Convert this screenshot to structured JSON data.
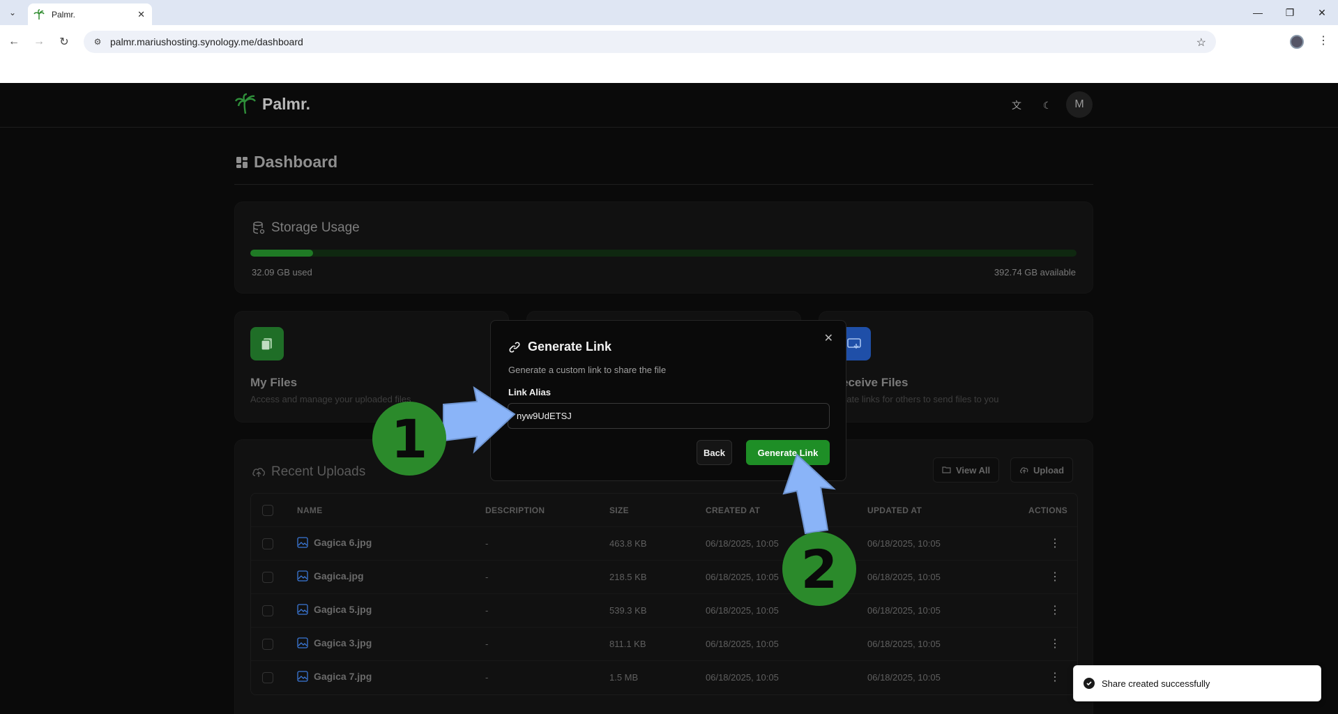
{
  "browser": {
    "tab_title": "Palmr.",
    "url": "palmr.mariushosting.synology.me/dashboard"
  },
  "app": {
    "logo_text": "Palmr.",
    "avatar_initial": "M",
    "page_title": "Dashboard",
    "storage": {
      "title": "Storage Usage",
      "used_label": "32.09 GB used",
      "available_label": "392.74 GB available",
      "used_fraction": 0.076
    },
    "quick": {
      "my_files_title": "My Files",
      "my_files_desc": "Access and manage your uploaded files",
      "receive_title": "eceive Files",
      "receive_desc": "eate links for others to send files to you"
    },
    "recent": {
      "title": "Recent Uploads",
      "view_all": "View All",
      "upload": "Upload",
      "columns": [
        "NAME",
        "DESCRIPTION",
        "SIZE",
        "CREATED AT",
        "UPDATED AT",
        "ACTIONS"
      ],
      "rows": [
        {
          "name": "Gagica 6.jpg",
          "description": "-",
          "size": "463.8 KB",
          "created": "06/18/2025, 10:05",
          "updated": "06/18/2025, 10:05"
        },
        {
          "name": "Gagica.jpg",
          "description": "-",
          "size": "218.5 KB",
          "created": "06/18/2025, 10:05",
          "updated": "06/18/2025, 10:05"
        },
        {
          "name": "Gagica 5.jpg",
          "description": "-",
          "size": "539.3 KB",
          "created": "06/18/2025, 10:05",
          "updated": "06/18/2025, 10:05"
        },
        {
          "name": "Gagica 3.jpg",
          "description": "-",
          "size": "811.1 KB",
          "created": "06/18/2025, 10:05",
          "updated": "06/18/2025, 10:05"
        },
        {
          "name": "Gagica 7.jpg",
          "description": "-",
          "size": "1.5 MB",
          "created": "06/18/2025, 10:05",
          "updated": "06/18/2025, 10:05"
        }
      ]
    }
  },
  "dialog": {
    "title": "Generate Link",
    "description": "Generate a custom link to share the file",
    "alias_label": "Link Alias",
    "alias_value": "nyw9UdETSJ",
    "back_label": "Back",
    "generate_label": "Generate Link"
  },
  "toast": {
    "message": "Share created successfully"
  },
  "annotations": {
    "step1": "1",
    "step2": "2"
  },
  "colors": {
    "accent": "#1e8e26",
    "arrow": "#8ab4f8",
    "badge": "#2b8a2b"
  }
}
